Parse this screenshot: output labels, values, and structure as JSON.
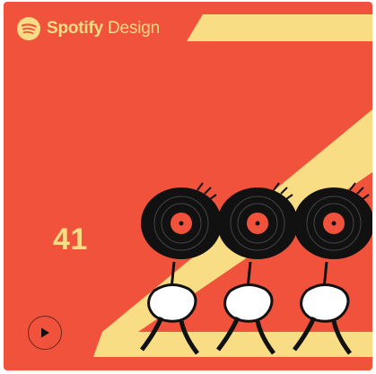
{
  "brand": {
    "word": "Spotify",
    "suffix": "Design"
  },
  "episode": {
    "number": "41"
  },
  "player": {
    "play_icon": "play-icon"
  },
  "colors": {
    "background": "#f0523b",
    "accent": "#f8dd85",
    "ink": "#111111",
    "glove": "#ffffff"
  }
}
